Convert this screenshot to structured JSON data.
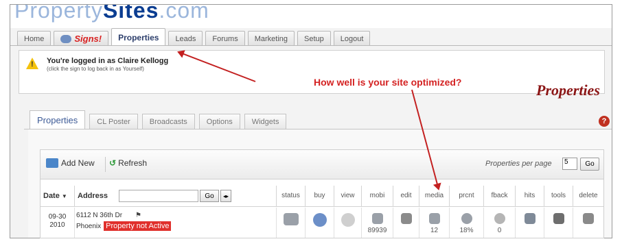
{
  "header": {
    "logo_part1": "Property",
    "logo_part2": "Sites",
    "logo_part3": ".com"
  },
  "main_tabs": [
    {
      "label": "Home"
    },
    {
      "label": "Signs!"
    },
    {
      "label": "Properties"
    },
    {
      "label": "Leads"
    },
    {
      "label": "Forums"
    },
    {
      "label": "Marketing"
    },
    {
      "label": "Setup"
    },
    {
      "label": "Logout"
    }
  ],
  "login": {
    "main": "You're logged in as Claire Kellogg",
    "sub": "(click the sign to log back in as Yourself)"
  },
  "annotation": "How well is your site optimized?",
  "page_heading": "Properties",
  "sub_tabs": [
    {
      "label": "Properties"
    },
    {
      "label": "CL Poster"
    },
    {
      "label": "Broadcasts"
    },
    {
      "label": "Options"
    },
    {
      "label": "Widgets"
    }
  ],
  "toolbar": {
    "add_new": "Add New",
    "refresh": "Refresh",
    "per_page_label": "Properties per page",
    "per_page_value": "5",
    "go": "Go"
  },
  "columns": {
    "date": "Date",
    "address": "Address",
    "address_go": "Go",
    "status": "status",
    "buy": "buy",
    "view": "view",
    "mobi": "mobi",
    "edit": "edit",
    "media": "media",
    "prcnt": "prcnt",
    "fback": "fback",
    "hits": "hits",
    "tools": "tools",
    "delete": "delete"
  },
  "row": {
    "date_line1": "09-30",
    "date_line2": "2010",
    "address_line1": "6112 N 36th Dr",
    "city": "Phoenix",
    "status_badge": "Property not Active",
    "mobi_count": "89939",
    "media_count": "12",
    "prcnt_value": "18%",
    "fback_count": "0"
  },
  "colors": {
    "accent": "#3c5a96",
    "alert_red": "#d42222",
    "badge_red": "#e0302c"
  }
}
